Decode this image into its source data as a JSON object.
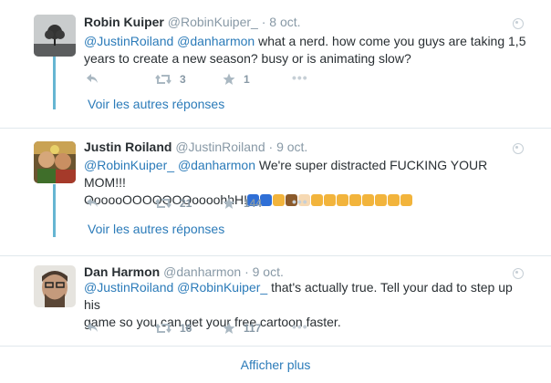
{
  "tweets": [
    {
      "name": "Robin Kuiper",
      "handle": "@RobinKuiper_",
      "sep": "·",
      "date": "8 oct.",
      "mention1": "@JustinRoiland",
      "mention2": "@danharmon",
      "text_line1_rest": " what a nerd. how come you guys are taking 1,5",
      "text_line2": "years to create a new season? busy or is animating slow?",
      "retweets": "3",
      "likes": "1",
      "replies_link": "Voir les autres réponses"
    },
    {
      "name": "Justin Roiland",
      "handle": "@JustinRoiland",
      "sep": "·",
      "date": "9 oct.",
      "mention1": "@RobinKuiper_",
      "mention2": "@danharmon",
      "text_line1_rest": " We're super distracted FUCKING YOUR MOM!!!",
      "text_line2": "OooooOOOOOOOoooohhH!",
      "emoji_colors": [
        "#2f6fd6",
        "#2f6fd6",
        "#f2b43c",
        "#8b5a2b",
        "#f6d9b3",
        "#f2b43c",
        "#f2b43c",
        "#f2b43c",
        "#f2b43c",
        "#f2b43c",
        "#f2b43c",
        "#f2b43c",
        "#f2b43c"
      ],
      "retweets": "21",
      "likes": "144",
      "replies_link": "Voir les autres réponses"
    },
    {
      "name": "Dan Harmon",
      "handle": "@danharmon",
      "sep": "·",
      "date": "9 oct.",
      "mention1": "@JustinRoiland",
      "mention2": "@RobinKuiper_",
      "text_line1_rest": " that's actually true. Tell your dad to step up his",
      "text_line2": "game so you can get your free cartoon faster.",
      "retweets": "16",
      "likes": "117"
    }
  ],
  "show_more": "Afficher plus"
}
